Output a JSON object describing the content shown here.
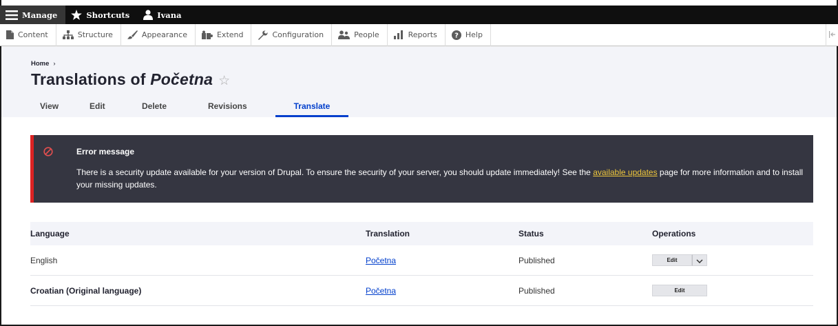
{
  "toolbar": {
    "manage_label": "Manage",
    "shortcuts_label": "Shortcuts",
    "user_label": "Ivana"
  },
  "tray": {
    "items": [
      "Content",
      "Structure",
      "Appearance",
      "Extend",
      "Configuration",
      "People",
      "Reports",
      "Help"
    ]
  },
  "breadcrumb": {
    "home": "Home",
    "separator": "›"
  },
  "page": {
    "title_prefix": "Translations of",
    "title_node": "Početna",
    "star": "☆"
  },
  "tabs": [
    "View",
    "Edit",
    "Delete",
    "Revisions",
    "Translate"
  ],
  "error": {
    "title": "Error message",
    "text_before": "There is a security update available for your version of Drupal. To ensure the security of your server, you should update immediately! See the ",
    "link": "available updates",
    "text_after": " page for more information and to install your missing updates."
  },
  "table": {
    "headers": [
      "Language",
      "Translation",
      "Status",
      "Operations"
    ],
    "rows": [
      {
        "language": "English",
        "translation": "Početna",
        "status": "Published",
        "operation": "Edit"
      },
      {
        "language": "Croatian (Original language)",
        "translation": "Početna",
        "status": "Published",
        "operation": "Edit"
      }
    ]
  },
  "colors": {
    "accent": "#003ecc",
    "error_bg": "#353641",
    "error_border": "#dc2323",
    "link_in_error": "#f0c83c"
  }
}
